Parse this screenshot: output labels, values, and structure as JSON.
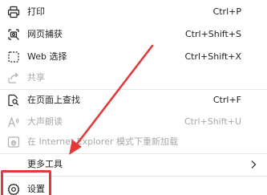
{
  "menu": {
    "items": [
      {
        "label": "打印",
        "shortcut": "Ctrl+P",
        "icon": "printer-icon",
        "disabled": false
      },
      {
        "label": "网页捕获",
        "shortcut": "Ctrl+Shift+S",
        "icon": "web-capture-icon",
        "disabled": false
      },
      {
        "label": "Web 选择",
        "shortcut": "Ctrl+Shift+X",
        "icon": "web-select-icon",
        "disabled": false
      },
      {
        "label": "共享",
        "shortcut": "",
        "icon": "share-icon",
        "disabled": true
      },
      {
        "label": "在页面上查找",
        "shortcut": "Ctrl+F",
        "icon": "find-on-page-icon",
        "disabled": false
      },
      {
        "label": "大声朗读",
        "shortcut": "Ctrl+Shift+U",
        "icon": "read-aloud-icon",
        "disabled": true
      },
      {
        "label": "在 Internet Explorer 模式下重新加载",
        "shortcut": "",
        "icon": "ie-mode-icon",
        "disabled": true
      },
      {
        "label": "更多工具",
        "shortcut": "",
        "icon": "",
        "disabled": false
      },
      {
        "label": "设置",
        "shortcut": "",
        "icon": "gear-icon",
        "disabled": false
      }
    ]
  },
  "annotation": {
    "color": "#e03a3a",
    "target": "设置"
  },
  "colors": {
    "text": "#1f1f1f",
    "disabled_text": "#a8a8a8",
    "divider": "#e6e6e6",
    "background": "#ffffff"
  }
}
